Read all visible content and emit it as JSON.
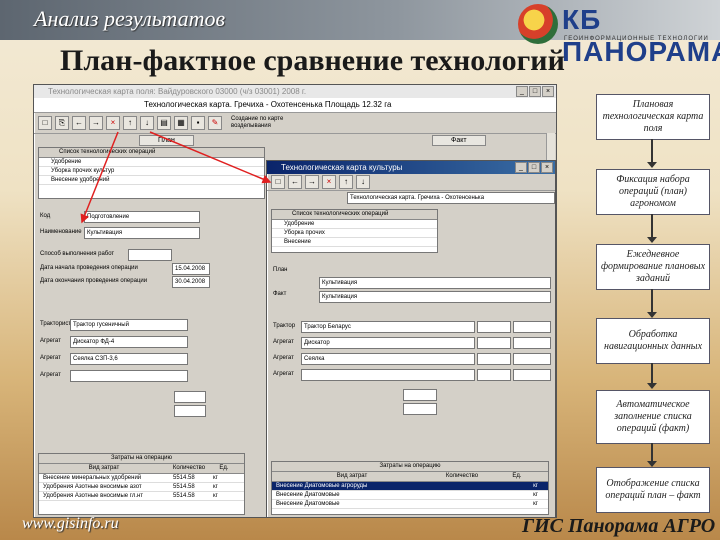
{
  "header": {
    "section_title": "Анализ результатов",
    "logo_text": "КБ ПАНОРАМА",
    "logo_subtext": "ГЕОИНФОРМАЦИОННЫЕ ТЕХНОЛОГИИ",
    "main_title": "План-фактное сравнение технологий"
  },
  "window1": {
    "title": "Технологическая карта поля: Вайдуровского 03000 (ч/з 03001) 2008 г.",
    "header_line": "Технологическая карта. Гречиха - Охотенсенька    Площадь 12.32 га",
    "toolbar_note": "Создание по карте возделывания",
    "tabs": [
      "План",
      "Факт"
    ],
    "list_header": "Список технологических операций",
    "list_rows": [
      "Удобрение",
      "Уборка прочих культур",
      "Внесение удобрений"
    ],
    "fields": {
      "code_label": "Код",
      "code_value": "Подготовление",
      "name_label": "Наименование",
      "name_value": "Культивация",
      "works_label": "Способ выполнения работ",
      "start_label": "Дата начала проведения операции",
      "start_value": "15.04.2008",
      "end_label": "Дата окончания проведения операции",
      "end_value": "30.04.2008"
    },
    "machine_rows": [
      {
        "label": "Тракторист",
        "value": "Трактор гусеничный"
      },
      {
        "label": "Агрегат",
        "value": "Дискатор ФД-4"
      },
      {
        "label": "Агрегат",
        "value": "Сеялка СЗП-3,6"
      },
      {
        "label": "Агрегат",
        "value": ""
      }
    ],
    "bottom_header": "Затраты на операцию",
    "bottom_columns": [
      "Вид затрат",
      "Количество",
      "Ед."
    ],
    "bottom_rows": [
      {
        "name": "Внесение минеральных удобрений",
        "qty": "5514.58",
        "unit": "кг"
      },
      {
        "name": "Удобрения Азотные вносимые азот",
        "qty": "5514.58",
        "unit": "кг"
      },
      {
        "name": "Удобрения Азотные вносимые гл.нт",
        "qty": "5514.58",
        "unit": "кг"
      }
    ]
  },
  "window2": {
    "title": "Технологическая карта культуры",
    "header_line": "Технологическая карта. Гречиха - Охотенсенька",
    "list_header": "Список технологических операций",
    "list_rows": [
      "Удобрение",
      "Уборка прочих",
      "Внесение"
    ],
    "plan_label": "План",
    "fact_label": "Факт",
    "field_values": [
      "Культивация",
      "Культивация"
    ],
    "machine_rows": [
      {
        "label": "Трактор",
        "value": "Трактор Беларус"
      },
      {
        "label": "Агрегат",
        "value": "Дискатор"
      },
      {
        "label": "Агрегат",
        "value": "Сеялка"
      },
      {
        "label": "Агрегат",
        "value": ""
      }
    ],
    "bottom_header": "Затраты на операцию",
    "bottom_columns": [
      "Вид затрат",
      "Количество",
      "Ед."
    ],
    "bottom_rows": [
      {
        "name": "Внесение Диатомовые агроруды",
        "qty": "",
        "unit": "кг",
        "selected": true
      },
      {
        "name": "Внесение Диатомовые",
        "qty": "",
        "unit": "кг",
        "selected": false
      },
      {
        "name": "Внесение Диатомовые",
        "qty": "",
        "unit": "кг",
        "selected": false
      }
    ]
  },
  "flow": [
    "Плановая технологическая карта поля",
    "Фиксация набора операций (план) агрономом",
    "Ежедневное формирование плановых заданий",
    "Обработка навигационных данных",
    "Автоматическое заполнение списка операций (факт)",
    "Отображение списка операций план – факт"
  ],
  "footer": {
    "left": "www.gisinfo.ru",
    "right": "ГИС Панорама АГРО"
  },
  "colors": {
    "header_band": "#5d6670",
    "title_active": "#0a246a",
    "annotation_red": "#e02020",
    "logo_blue": "#1f3f8a"
  }
}
